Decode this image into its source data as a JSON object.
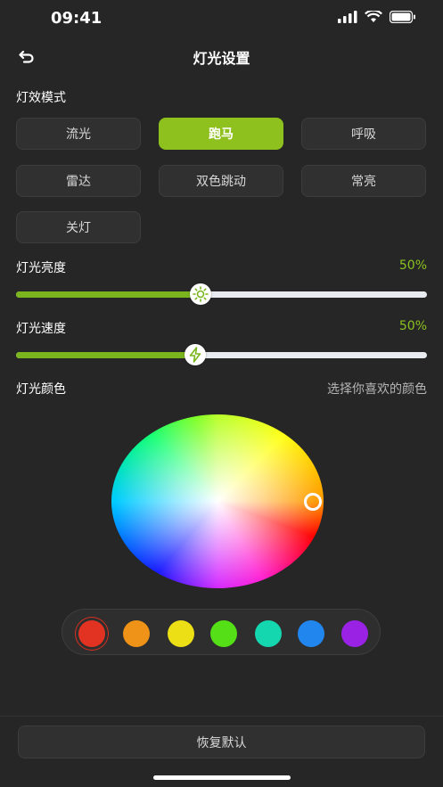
{
  "status_bar": {
    "time": "09:41"
  },
  "nav": {
    "title": "灯光设置"
  },
  "effects": {
    "label": "灯效模式",
    "modes": [
      "流光",
      "跑马",
      "呼吸",
      "雷达",
      "双色跳动",
      "常亮",
      "关灯"
    ],
    "selected": "跑马"
  },
  "brightness": {
    "label": "灯光亮度",
    "value_text": "50%",
    "value": 0.45
  },
  "speed": {
    "label": "灯光速度",
    "value_text": "50%",
    "value": 0.435
  },
  "color": {
    "label": "灯光颜色",
    "hint": "选择你喜欢的颜色",
    "swatches": [
      "#e23322",
      "#ee9317",
      "#ecdf16",
      "#54df17",
      "#14d6af",
      "#2187ee",
      "#9922e4"
    ],
    "selected_swatch": "#e23322"
  },
  "footer": {
    "reset_label": "恢复默认"
  },
  "colors": {
    "accent": "#8fc11e",
    "background": "#262626"
  },
  "icons": {
    "back": "back-arrow-icon",
    "brightness_thumb": "sun-icon",
    "speed_thumb": "lightning-icon"
  }
}
